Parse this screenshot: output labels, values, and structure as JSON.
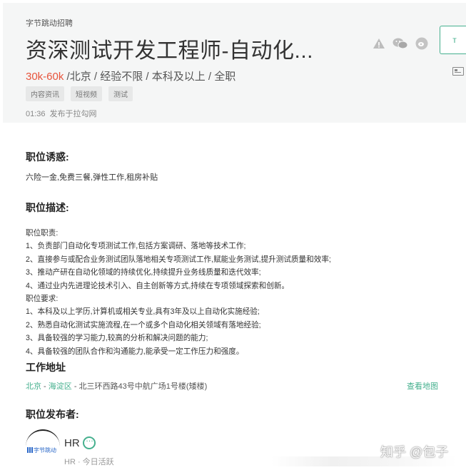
{
  "job": {
    "company": "字节跳动招聘",
    "title": "资深测试开发工程师-自动化...",
    "salary": "30k-60k",
    "meta": " /北京 / 经验不限 / 本科及以上 / 全职",
    "tags": [
      "内容资讯",
      "短视频",
      "测试"
    ],
    "publish_time": "01:36",
    "publish_source": "发布于拉勾网"
  },
  "header_actions": {
    "icons": [
      "warning-icon",
      "wechat-icon",
      "weibo-icon"
    ],
    "apply_label": "т",
    "resume_label": ""
  },
  "sections": {
    "perks_title": "职位诱惑:",
    "perks_text": "六险一金,免费三餐,弹性工作,租房补贴",
    "desc_title": "职位描述:",
    "desc_lines": [
      "职位职责:",
      "1、负责部门自动化专项测试工作,包括方案调研、落地等技术工作;",
      "2、直接参与或配合业务测试团队落地相关专项测试工作,赋能业务测试,提升测试质量和效率;",
      "3、推动产研在自动化领域的持续优化,持续提升业务线质量和迭代效率;",
      "4、通过业内先进理论技术引入、自主创新等方式,持续在专项领域探索和创新。",
      "职位要求:",
      "1、本科及以上学历,计算机或相关专业,具有3年及以上自动化实施经验;",
      "2、熟悉自动化测试实施流程,在一个或多个自动化相关领域有落地经验;",
      "3、具备较强的学习能力,较高的分析和解决问题的能力;",
      "4、具备较强的团队合作和沟通能力,能承受一定工作压力和强度。"
    ],
    "address_title": "工作地址",
    "address_city": "北京",
    "address_sep1": " - ",
    "address_district": "海淀区",
    "address_rest": " - 北三环西路43号中航广场1号楼(矮楼)",
    "map_link": "查看地图",
    "publisher_title": "职位发布者:"
  },
  "publisher": {
    "avatar_text": "字节跳动",
    "name": "HR",
    "status": "HR · 今日活跃"
  },
  "watermark": "知乎 @包子"
}
